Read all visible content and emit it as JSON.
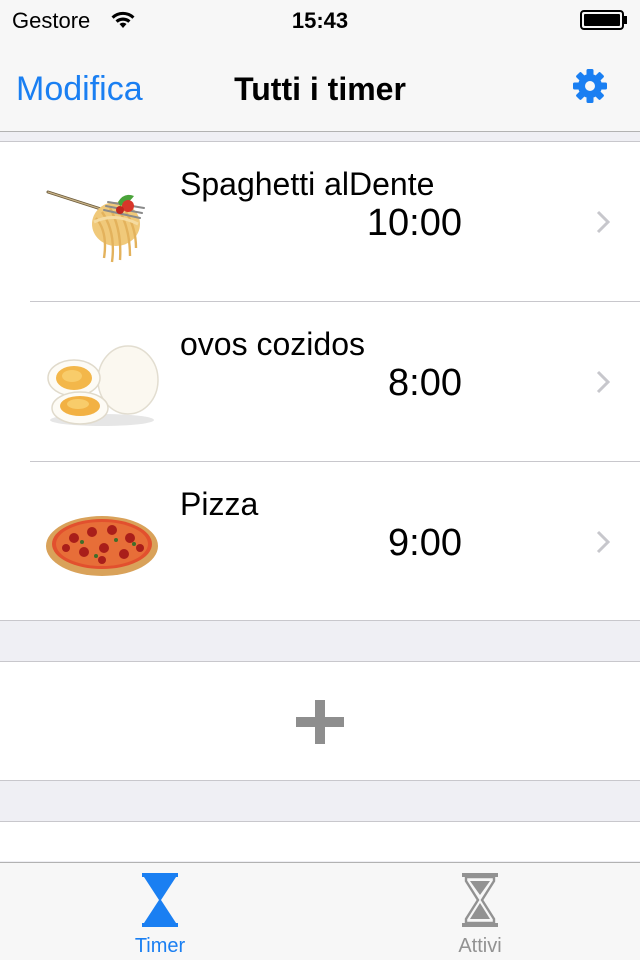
{
  "status_bar": {
    "carrier": "Gestore",
    "time": "15:43",
    "wifi_icon": "wifi-icon",
    "battery_icon": "battery-icon"
  },
  "nav": {
    "edit_label": "Modifica",
    "title": "Tutti i timer",
    "settings_icon": "gear-icon",
    "accent_color": "#1a7ff2"
  },
  "timers": [
    {
      "name": "Spaghetti alDente",
      "time": "10:00",
      "icon": "spaghetti-fork-icon"
    },
    {
      "name": "ovos cozidos",
      "time": "8:00",
      "icon": "boiled-eggs-icon"
    },
    {
      "name": "Pizza",
      "time": "9:00",
      "icon": "pizza-icon"
    }
  ],
  "add_row": {
    "icon": "plus-icon"
  },
  "tab_bar": {
    "tabs": [
      {
        "label": "Timer",
        "icon": "hourglass-icon",
        "active": true,
        "color": "#1a7ff2"
      },
      {
        "label": "Attivi",
        "icon": "hourglass-icon",
        "active": false,
        "color": "#929292"
      }
    ]
  }
}
